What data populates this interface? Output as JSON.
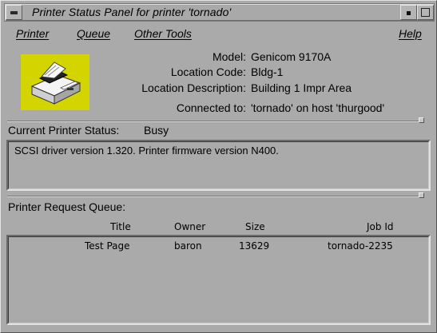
{
  "window": {
    "title": "Printer Status Panel for printer 'tornado'"
  },
  "menubar": {
    "items": [
      "Printer",
      "Queue",
      "Other Tools",
      "Help"
    ]
  },
  "printer_info": {
    "model_label": "Model:",
    "model_value": "Genicom 9170A",
    "location_code_label": "Location Code:",
    "location_code_value": "Bldg-1",
    "location_desc_label": "Location Description:",
    "location_desc_value": "Building 1 Impr Area",
    "connected_label": "Connected to:",
    "connected_value": "'tornado' on host 'thurgood'"
  },
  "status": {
    "label": "Current Printer Status:",
    "value": "Busy",
    "message": "SCSI driver version 1.320. Printer firmware version N400."
  },
  "queue": {
    "label": "Printer Request Queue:",
    "columns": [
      "Title",
      "Owner",
      "Size",
      "Job Id"
    ],
    "rows": [
      {
        "title": "Test Page",
        "owner": "baron",
        "size": "13629",
        "job_id": "tornado-2235"
      }
    ]
  },
  "icons": {
    "window_menu": "window-menu-icon",
    "minimize": "minimize-icon",
    "maximize": "maximize-icon",
    "printer": "printer-icon"
  },
  "colors": {
    "background": "#aaaaaa",
    "icon_highlight": "#d8d800"
  }
}
